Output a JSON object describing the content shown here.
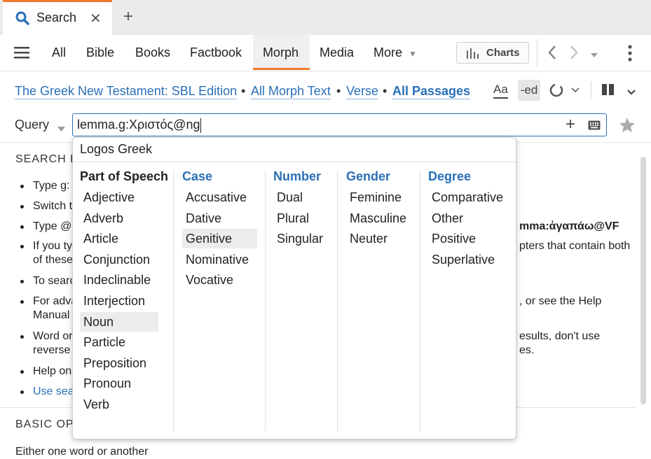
{
  "tab": {
    "title": "Search",
    "close": "✕",
    "new": "+"
  },
  "nav": {
    "tabs": [
      "All",
      "Bible",
      "Books",
      "Factbook",
      "Morph",
      "Media",
      "More"
    ],
    "active": "Morph",
    "charts_label": "Charts"
  },
  "source": {
    "resource": "The Greek New Testament: SBL Edition",
    "text": "All Morph Text",
    "unit": "Verse",
    "range": "All Passages",
    "sep": "•",
    "font_btn": "Aa",
    "ed_btn": "-ed"
  },
  "query": {
    "label": "Query",
    "value": "lemma.g:Χριστός@ng",
    "add": "+"
  },
  "help": {
    "title": "SEARCH H",
    "lines": [
      "Type g:",
      "Switch t",
      "Type @",
      "If you ty",
      "of these",
      "To searc",
      "For adva",
      "Manual",
      "Word or",
      "reverse",
      "Help on",
      "Use sea"
    ],
    "right_fragments": [
      "mma:ἀγαπάω@VF",
      "pters that contain both",
      ", or see the Help",
      "esults, don't use",
      "es."
    ],
    "basic_title": "BASIC OP",
    "cut_line": "Either one word or another"
  },
  "dropdown": {
    "title": "Logos Greek",
    "columns": [
      {
        "header": "Part of Speech",
        "header_color": "#222222",
        "items": [
          "Adjective",
          "Adverb",
          "Article",
          "Conjunction",
          "Indeclinable",
          "Interjection",
          "Noun",
          "Particle",
          "Preposition",
          "Pronoun",
          "Verb"
        ],
        "highlight": "Noun"
      },
      {
        "header": "Case",
        "header_color": "#2a6fb8",
        "items": [
          "Accusative",
          "Dative",
          "Genitive",
          "Nominative",
          "Vocative"
        ],
        "highlight": "Genitive"
      },
      {
        "header": "Number",
        "header_color": "#2a6fb8",
        "items": [
          "Dual",
          "Plural",
          "Singular"
        ],
        "highlight": ""
      },
      {
        "header": "Gender",
        "header_color": "#2a6fb8",
        "items": [
          "Feminine",
          "Masculine",
          "Neuter"
        ],
        "highlight": ""
      },
      {
        "header": "Degree",
        "header_color": "#2a6fb8",
        "items": [
          "Comparative",
          "Other",
          "Positive",
          "Superlative"
        ],
        "highlight": ""
      }
    ]
  },
  "colors": {
    "accent": "#f0782a",
    "link": "#2a6fb8"
  }
}
